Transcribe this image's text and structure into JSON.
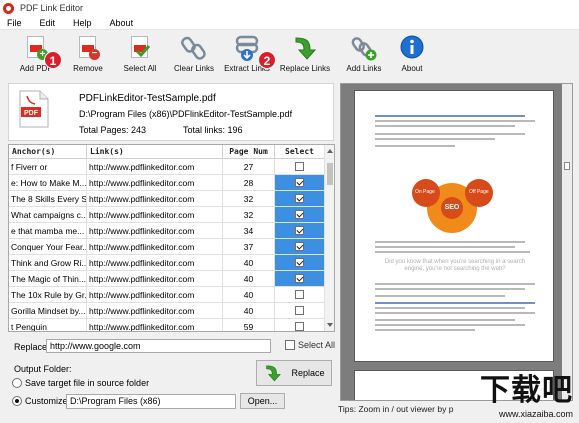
{
  "window": {
    "title": "PDF Link Editor"
  },
  "menu": [
    "File",
    "Edit",
    "Help",
    "About"
  ],
  "toolbar": {
    "buttons": [
      {
        "label": "Add PDF",
        "icon": "pdf-add-icon"
      },
      {
        "label": "Remove",
        "icon": "pdf-remove-icon"
      },
      {
        "label": "Select All",
        "icon": "select-all-icon"
      },
      {
        "label": "Clear Links",
        "icon": "chain-broken-icon"
      },
      {
        "label": "Extract Links",
        "icon": "extract-links-icon"
      },
      {
        "label": "Replace Links",
        "icon": "replace-arrow-icon"
      },
      {
        "label": "Add Links",
        "icon": "add-link-icon"
      },
      {
        "label": "About",
        "icon": "info-icon"
      }
    ],
    "badges": [
      "1",
      "2"
    ]
  },
  "file": {
    "name": "PDFLinkEditor-TestSample.pdf",
    "path": "D:\\Program Files (x86)\\PDFlinkEditor-TestSample.pdf",
    "total_pages": "Total Pages: 243",
    "total_links": "Total links: 196"
  },
  "table": {
    "headers": [
      "Anchor(s)",
      "Link(s)",
      "Page Num",
      "Select"
    ],
    "rows": [
      {
        "anchor": "f Fiverr or",
        "link": "http://www.pdflinkeditor.com",
        "page": "27",
        "checked": false,
        "selected": false
      },
      {
        "anchor": "e: How to Make M...",
        "link": "http://www.pdflinkeditor.com",
        "page": "28",
        "checked": true,
        "selected": true
      },
      {
        "anchor": "The 8 Skills Every S...",
        "link": "http://www.pdflinkeditor.com",
        "page": "32",
        "checked": true,
        "selected": true
      },
      {
        "anchor": "What campaigns c...",
        "link": "http://www.pdflinkeditor.com",
        "page": "32",
        "checked": true,
        "selected": true
      },
      {
        "anchor": "e that mamba me...",
        "link": "http://www.pdflinkeditor.com",
        "page": "34",
        "checked": true,
        "selected": true
      },
      {
        "anchor": "Conquer Your Fear...",
        "link": "http://www.pdflinkeditor.com",
        "page": "37",
        "checked": true,
        "selected": true
      },
      {
        "anchor": "Think and Grow Ri...",
        "link": "http://www.pdflinkeditor.com",
        "page": "40",
        "checked": true,
        "selected": true
      },
      {
        "anchor": "The Magic of Thin...",
        "link": "http://www.pdflinkeditor.com",
        "page": "40",
        "checked": true,
        "selected": true
      },
      {
        "anchor": "The 10x Rule by Gr...",
        "link": "http://www.pdflinkeditor.com",
        "page": "40",
        "checked": false,
        "selected": false
      },
      {
        "anchor": "Gorilla Mindset by...",
        "link": "http://www.pdflinkeditor.com",
        "page": "40",
        "checked": false,
        "selected": false
      },
      {
        "anchor": "t Penguin",
        "link": "http://www.pdflinkeditor.com",
        "page": "59",
        "checked": false,
        "selected": false
      }
    ]
  },
  "replace": {
    "label": "Replace:",
    "value": "http://www.google.com",
    "select_all_label": "Select All",
    "button_label": "Replace"
  },
  "output": {
    "label": "Output Folder:",
    "option_source": "Save target file in source folder",
    "option_custom": "Customize:",
    "custom_path": "D:\\Program Files (x86)",
    "open_label": "Open..."
  },
  "preview": {
    "tips": "Tips: Zoom in / out viewer by p",
    "seo_center": "SEO",
    "on_page": "On Page",
    "off_page": "Off Page",
    "callout": "Did you know that when you're searching in a search engine, you're not searching the web?"
  },
  "watermark": {
    "big": "下载吧",
    "small": "www.xiazaiba.com"
  }
}
